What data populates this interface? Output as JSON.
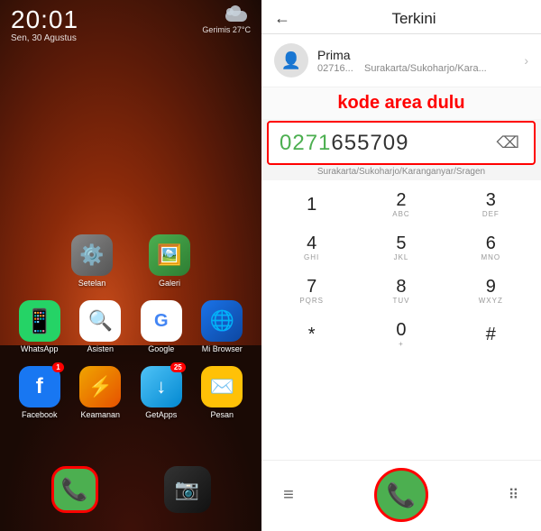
{
  "left": {
    "time": "20:01",
    "day": "Sen, 30 Agustus",
    "weather_text": "Gerimis 27°C",
    "apps_row1": [
      {
        "label": "Setelan",
        "icon_class": "icon-setelan",
        "icon": "⚙️"
      },
      {
        "label": "Galeri",
        "icon_class": "icon-galeri",
        "icon": "🖼️"
      }
    ],
    "apps_row2": [
      {
        "label": "WhatsApp",
        "icon_class": "icon-whatsapp",
        "icon": "💬"
      },
      {
        "label": "Asisten",
        "icon_class": "icon-asisten",
        "icon": "🔍"
      },
      {
        "label": "Google",
        "icon_class": "icon-google",
        "icon": "G"
      },
      {
        "label": "Mi Browser",
        "icon_class": "icon-mibrowser",
        "icon": "🌐"
      }
    ],
    "apps_row3": [
      {
        "label": "Facebook",
        "icon_class": "icon-facebook",
        "icon": "f",
        "badge": "1"
      },
      {
        "label": "Keamanan",
        "icon_class": "icon-keamanan",
        "icon": "⚡"
      },
      {
        "label": "GetApps",
        "icon_class": "icon-getapps",
        "icon": "↓",
        "badge": "25"
      },
      {
        "label": "Pesan",
        "icon_class": "icon-pesan",
        "icon": "✉️"
      }
    ],
    "dock": [
      {
        "label": "Phone",
        "icon": "📞",
        "highlighted": true
      },
      {
        "label": "Camera",
        "icon": "📷",
        "highlighted": false
      }
    ]
  },
  "right": {
    "back_arrow": "←",
    "title": "Terkini",
    "recent_contact": {
      "name": "Prima",
      "number": "02716...",
      "location": "Surakarta/Sukoharjo/Kara..."
    },
    "annotation": "kode area dulu",
    "input": {
      "area_code": "0271",
      "rest": "655709",
      "location": "Surakarta/Sukoharjo/Karanganyar/Sragen"
    },
    "keypad": [
      [
        {
          "main": "1",
          "sub": ""
        },
        {
          "main": "2",
          "sub": "ABC"
        },
        {
          "main": "3",
          "sub": "DEF"
        }
      ],
      [
        {
          "main": "4",
          "sub": "GHI"
        },
        {
          "main": "5",
          "sub": "JKL"
        },
        {
          "main": "6",
          "sub": "MNO"
        }
      ],
      [
        {
          "main": "7",
          "sub": "PQRS"
        },
        {
          "main": "8",
          "sub": "TUV"
        },
        {
          "main": "9",
          "sub": "WXYZ"
        }
      ],
      [
        {
          "main": "*",
          "sub": ""
        },
        {
          "main": "0",
          "sub": "+"
        },
        {
          "main": "#",
          "sub": ""
        }
      ]
    ],
    "bottom_actions": {
      "menu_icon": "≡",
      "call_icon": "📞",
      "grid_icon": "⠿"
    }
  }
}
